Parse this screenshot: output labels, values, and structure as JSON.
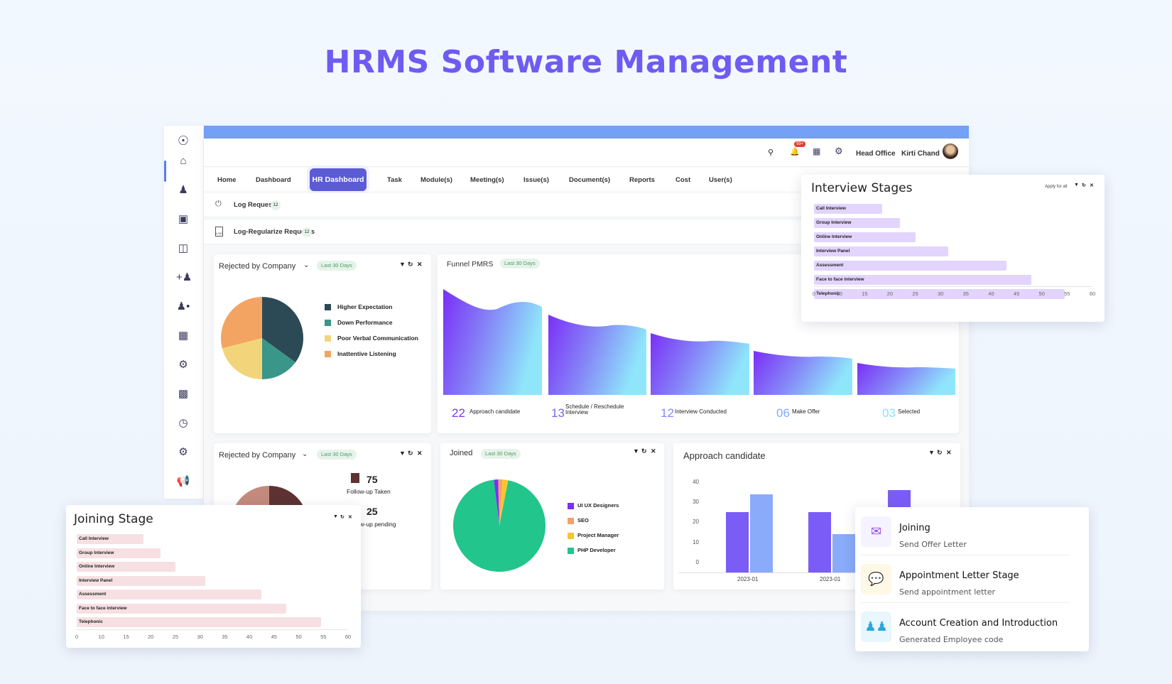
{
  "title": "HRMS Software Management",
  "header": {
    "location": "Head Office",
    "user": "Kirti Chand",
    "notification_badge": "99+"
  },
  "tabs": [
    "Home",
    "Dashboard",
    "HR Dashboard",
    "Task",
    "Module(s)",
    "Meeting(s)",
    "Issue(s)",
    "Document(s)",
    "Reports",
    "Cost",
    "User(s)"
  ],
  "requests": [
    {
      "label": "Log Request",
      "count": "12"
    },
    {
      "label": "Log-Regularize Requests",
      "count": "12",
      "icon_text": "LOG"
    }
  ],
  "range_label": "Last 30 Days",
  "rejected": {
    "title": "Rejected by Company",
    "chart_data": {
      "type": "pie",
      "labels": [
        "Higher Expectation",
        "Down Performance",
        "Poor Verbal Communication",
        "Inattentive Listening"
      ],
      "values": [
        35,
        15,
        21,
        29
      ],
      "colors": [
        "#2c4a55",
        "#3a9688",
        "#f2d57a",
        "#f4a462"
      ]
    }
  },
  "rejected2": {
    "title": "Rejected by Company",
    "items": [
      {
        "value": "75",
        "label": "Follow-up Taken",
        "color": "#5e3232"
      },
      {
        "value": "25",
        "label": "Follow-up pending",
        "color": "#c48a7d"
      }
    ]
  },
  "funnel": {
    "title": "Funnel PMRS",
    "stages": [
      {
        "value": "22",
        "label": "Approach candidate",
        "color": "#7b35f6"
      },
      {
        "value": "13",
        "label": "Schedule / Reschedule Interview",
        "color": "#7c63f5"
      },
      {
        "value": "12",
        "label": "Interview Conducted",
        "color": "#8688f7"
      },
      {
        "value": "06",
        "label": "Make Offer",
        "color": "#86aaf8"
      },
      {
        "value": "03",
        "label": "Selected",
        "color": "#8de0fa"
      }
    ]
  },
  "joined": {
    "title": "Joined",
    "chart_data": {
      "type": "pie",
      "labels": [
        "UI UX Designers",
        "SEO",
        "Project Manager",
        "PHP Developer"
      ],
      "values": [
        1.5,
        1.5,
        2,
        95
      ],
      "colors": [
        "#7b2ff7",
        "#f4a06a",
        "#f8c62a",
        "#22c58b"
      ]
    }
  },
  "approach": {
    "title": "Approach candidate",
    "chart_data": {
      "type": "bar",
      "categories": [
        "2023-01",
        "2023-01",
        ""
      ],
      "series": [
        {
          "values": [
            25,
            25,
            36
          ],
          "color": "#7b5cf6"
        },
        {
          "values": [
            34,
            14,
            null
          ],
          "color": "#8aabfa"
        }
      ],
      "yticks": [
        0,
        10,
        20,
        30,
        40
      ],
      "ylim": [
        0,
        40
      ]
    }
  },
  "interview_stages": {
    "title": "Interview Stages",
    "apply_label": "Apply for all",
    "chart_data": {
      "type": "bar",
      "orientation": "horizontal",
      "categories": [
        "Call Interview",
        "Group Interview",
        "Online Interview",
        "Interview Panel",
        "Assessment",
        "Face to face interview",
        "Telephonic"
      ],
      "values": [
        18.5,
        22,
        25,
        31.5,
        43,
        48,
        54.5
      ],
      "xticks": [
        0,
        10,
        15,
        20,
        25,
        30,
        35,
        40,
        45,
        50,
        55,
        60
      ],
      "color": "#e2d4fd"
    }
  },
  "joining_stage": {
    "title": "Joining Stage",
    "chart_data": {
      "type": "bar",
      "orientation": "horizontal",
      "categories": [
        "Call Interview",
        "Group Interview",
        "Online Interview",
        "Interview Panel",
        "Assessment",
        "Face to face interview",
        "Telephonic"
      ],
      "values": [
        18.5,
        22,
        25,
        31,
        42.5,
        47.5,
        54.5
      ],
      "xticks": [
        0,
        10,
        15,
        20,
        25,
        30,
        35,
        40,
        45,
        50,
        55,
        60
      ],
      "color": "#f6e0e3"
    }
  },
  "joining_list": [
    {
      "title": "Joining",
      "subtitle": "Send Offer Letter",
      "icon": "envelope-icon",
      "bg": "#f5f3ff",
      "fg": "#9b4fe8"
    },
    {
      "title": "Appointment Letter Stage",
      "subtitle": "Send appointment letter",
      "icon": "chat-bubble-icon",
      "bg": "#fff8e6",
      "fg": "#f5b800"
    },
    {
      "title": "Account Creation and Introduction",
      "subtitle": "Generated Employee code",
      "icon": "team-icon",
      "bg": "#e8f6fd",
      "fg": "#2aa6e0"
    }
  ]
}
